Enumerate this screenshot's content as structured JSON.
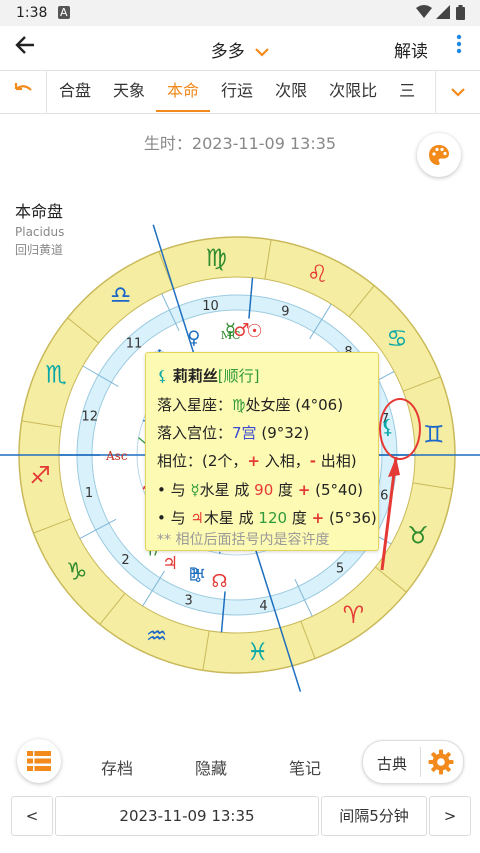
{
  "status": {
    "time": "1:38",
    "a_badge": "A",
    "wifi_icon": "wifi-icon",
    "signal_icon": "signal-icon",
    "battery_icon": "battery-icon"
  },
  "appbar": {
    "title": "多多",
    "read_label": "解读",
    "more_icon": "more-vert-icon"
  },
  "tabs": [
    "合盘",
    "天象",
    "本命",
    "行运",
    "次限",
    "次限比",
    "三"
  ],
  "active_tab": "本命",
  "birth_label": "生时：2023-11-09 13:35",
  "chart_title": "本命盘",
  "house_system": "Placidus",
  "zodiac_type": "回归黄道",
  "wheel": {
    "signs": [
      "♈",
      "♉",
      "♊",
      "♋",
      "♌",
      "♍",
      "♎",
      "♏",
      "♐",
      "♑",
      "♒",
      "♓"
    ],
    "house_numbers": [
      "1",
      "2",
      "3",
      "4",
      "5",
      "6",
      "7",
      "8",
      "9",
      "10",
      "11",
      "12"
    ],
    "asc_label": "Asc",
    "mc_label": "MC",
    "highlighted_point": "莉莉丝",
    "colors": {
      "sign_ring": "#f5eda1",
      "house_ring": "#d9f1fb",
      "fire": "#e53935",
      "earth": "#2e8b2e",
      "air": "#1a66c9",
      "water": "#0aa8a8",
      "accent": "#f28a1c"
    }
  },
  "popup": {
    "symbol": "⚸",
    "name": "莉莉丝",
    "motion": "[顺行]",
    "sign_label": "落入星座：",
    "sign_symbol": "♍",
    "sign_value": "处女座 (4°06)",
    "house_label": "落入宫位：",
    "house_value": "7宫",
    "house_degree": "(9°32)",
    "aspect_prefix": "相位：(2个，",
    "aspect_in_sign": "+",
    "aspect_in_text": " 入相，",
    "aspect_out_sign": "-",
    "aspect_out_text": " 出相)",
    "aspects": [
      {
        "prefix": "• 与 ",
        "planet_symbol": "☿",
        "planet": "水星",
        "mid": " 成 ",
        "angle": "90",
        "deg": " 度 ",
        "sign": "+",
        "orb": " (5°40)"
      },
      {
        "prefix": "• 与 ",
        "planet_symbol": "♃",
        "planet": "木星",
        "mid": " 成 ",
        "angle": "120",
        "deg": " 度 ",
        "sign": "+",
        "orb": " (5°36)"
      }
    ],
    "note": "** 相位后面括号内是容许度"
  },
  "bottom": {
    "archive": "存档",
    "hide": "隐藏",
    "notes": "笔记",
    "classic": "古典"
  },
  "datebar": {
    "prev": "<",
    "datetime": "2023-11-09 13:35",
    "interval": "间隔5分钟",
    "next": ">"
  }
}
